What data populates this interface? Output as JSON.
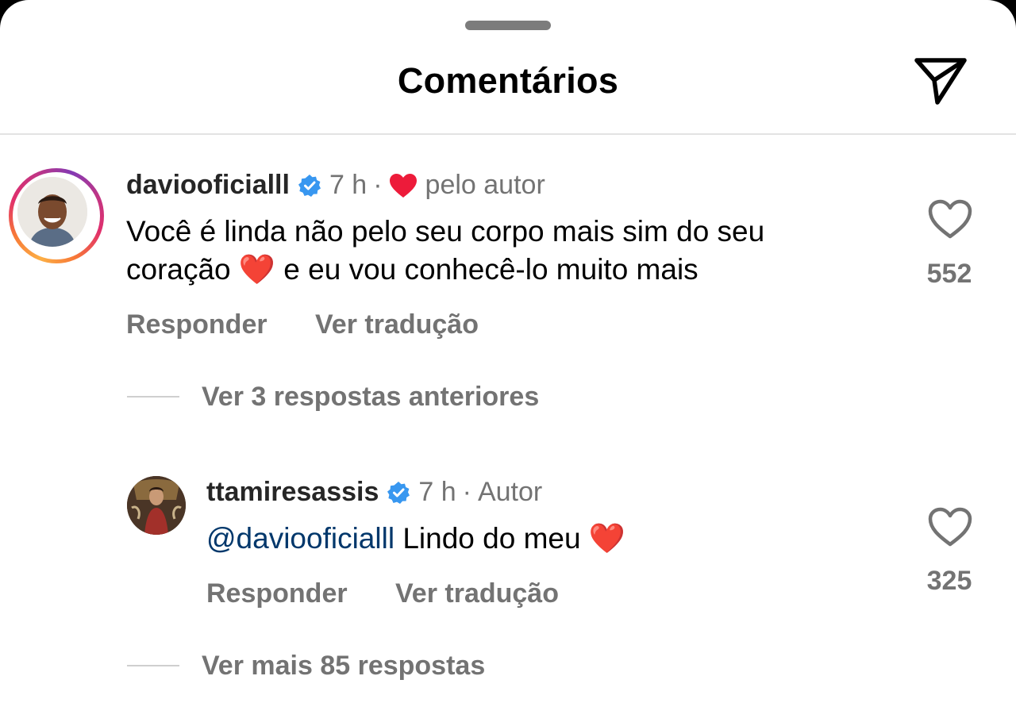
{
  "header": {
    "title": "Comentários",
    "share_icon": "paper-plane-icon"
  },
  "comments": [
    {
      "username": "daviooficialll",
      "verified": true,
      "time": "7 h",
      "separator": "·",
      "liked_by_author": "pelo autor",
      "text": "Você é linda não pelo seu corpo mais sim do seu",
      "text_line2_pre": "coração",
      "text_line2_post": "e eu vou conhecê-lo muito mais",
      "emoji": "❤️",
      "like_count": "552",
      "reply_label": "Responder",
      "translate_label": "Ver tradução",
      "view_previous_replies": "Ver 3 respostas anteriores"
    },
    {
      "username": "ttamiresassis",
      "verified": true,
      "time": "7 h",
      "separator": "·",
      "role": "Autor",
      "mention": "@daviooficialll",
      "text": "Lindo do meu",
      "emoji": "❤️",
      "like_count": "325",
      "reply_label": "Responder",
      "translate_label": "Ver tradução",
      "view_more_replies": "Ver mais 85 respostas"
    }
  ],
  "colors": {
    "accent_verified": "#3897f0",
    "heart_red": "#ed1b3a",
    "muted_text": "#737373",
    "mention": "#00376b"
  }
}
